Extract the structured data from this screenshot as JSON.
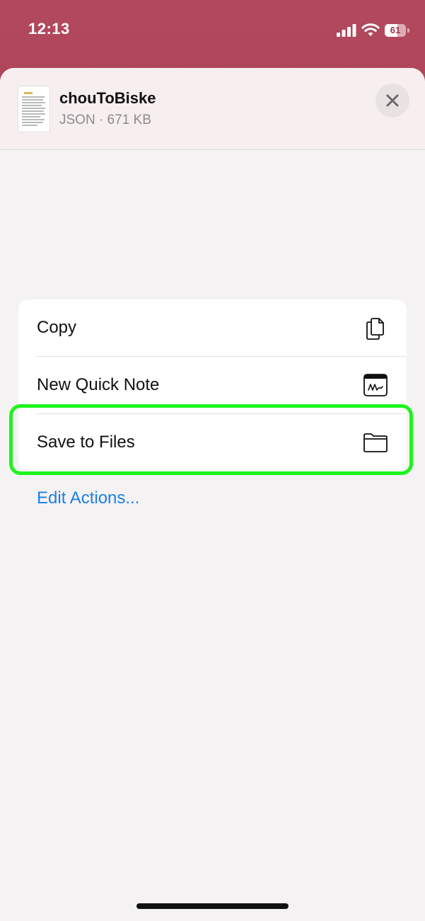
{
  "status_bar": {
    "time": "12:13",
    "battery_level": "61",
    "battery_fraction": 0.61
  },
  "file": {
    "name": "chouToBiske",
    "meta": "JSON · 671 KB",
    "thumbnail_icon": "document-thumbnail-icon"
  },
  "close_icon": "close-icon",
  "actions": [
    {
      "label": "Copy",
      "icon": "copy-icon"
    },
    {
      "label": "New Quick Note",
      "icon": "quick-note-icon"
    },
    {
      "label": "Save to Files",
      "icon": "folder-icon"
    }
  ],
  "edit_actions_label": "Edit Actions...",
  "colors": {
    "accent_link": "#1a7fe8",
    "highlight_outline": "#1ef41e",
    "background_tint": "#b2485c"
  }
}
